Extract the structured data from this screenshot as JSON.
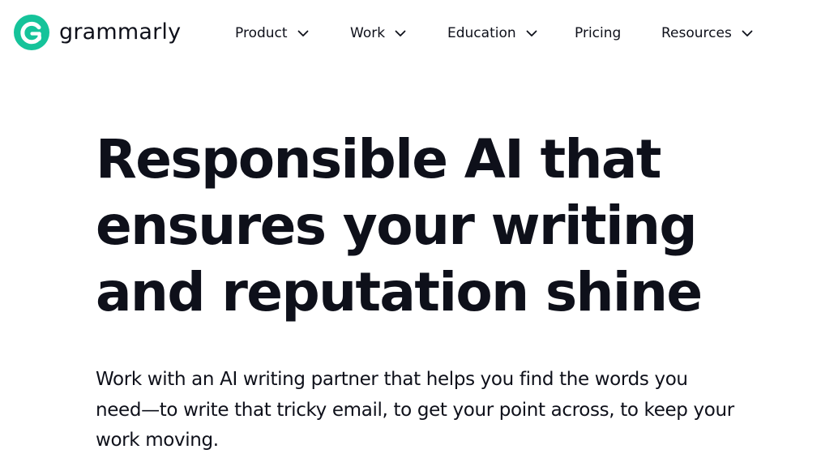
{
  "brand": {
    "name": "grammarly",
    "logo_icon": "grammarly-g-icon",
    "color": "#15c39a"
  },
  "nav": {
    "items": [
      {
        "label": "Product",
        "has_dropdown": true
      },
      {
        "label": "Work",
        "has_dropdown": true
      },
      {
        "label": "Education",
        "has_dropdown": true
      },
      {
        "label": "Pricing",
        "has_dropdown": false
      },
      {
        "label": "Resources",
        "has_dropdown": true
      }
    ],
    "dropdown_icon": "chevron-down-icon"
  },
  "hero": {
    "title": "Responsible AI that ensures your writing and reputation shine",
    "subtitle": "Work with an AI writing partner that helps you find the words you need—to write that tricky email, to get your point across, to keep your work moving."
  },
  "colors": {
    "text": "#0e101a",
    "background": "#ffffff"
  }
}
